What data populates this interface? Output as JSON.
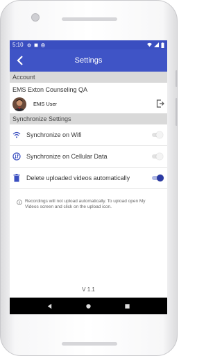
{
  "status_bar": {
    "time": "5:10"
  },
  "app_bar": {
    "title": "Settings"
  },
  "account": {
    "header": "Account",
    "organization": "EMS Exton Counseling QA",
    "user_name": "EMS User"
  },
  "sync": {
    "header": "Synchronize Settings",
    "wifi_label": "Synchronize on Wifi",
    "wifi_enabled": false,
    "cellular_label": "Synchronize on Cellular Data",
    "cellular_enabled": false,
    "delete_label": "Delete uploaded videos automatically",
    "delete_enabled": true
  },
  "note": "Recordings will not upload automatically. To upload open My Videos screen and click on the upload icon.",
  "version": "V 1.1",
  "colors": {
    "app_bar": "#3f54c6",
    "status_bar": "#3a4ec0",
    "accent": "#2b3aa4",
    "icon_blue": "#3a4ec0"
  }
}
